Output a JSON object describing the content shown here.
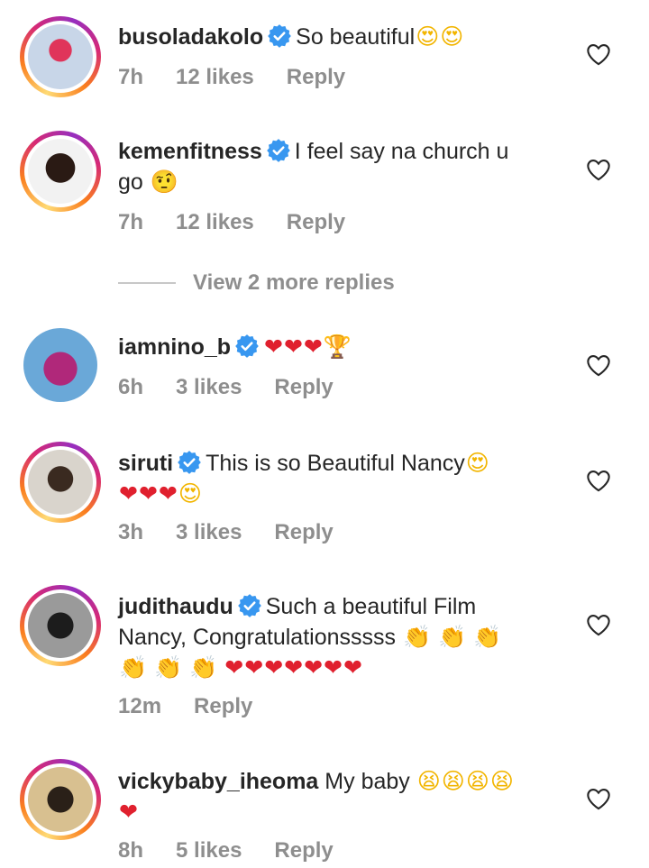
{
  "comments": [
    {
      "username": "busoladakolo",
      "verified": true,
      "text": "So beautiful",
      "emojis_inline": [
        "😍",
        "😍"
      ],
      "emojis_line2": [],
      "time": "7h",
      "likes": "12 likes",
      "reply": "Reply",
      "avatar_colors": [
        "#c8d6e8",
        "#e0345a"
      ]
    },
    {
      "username": "kemenfitness",
      "verified": true,
      "text": "I feel say na church u",
      "text_line2": "go",
      "emojis_line2": [
        "🤨"
      ],
      "time": "7h",
      "likes": "12 likes",
      "reply": "Reply",
      "avatar_colors": [
        "#f2f2f2",
        "#2a1a14"
      ]
    },
    {
      "username": "iamnino_b",
      "verified": true,
      "text": "",
      "emojis_inline": [
        "❤",
        "❤",
        "❤",
        "🏆"
      ],
      "time": "6h",
      "likes": "3 likes",
      "reply": "Reply",
      "avatar_colors": [
        "#6aa8d8",
        "#b0287a"
      ]
    },
    {
      "username": "siruti",
      "verified": true,
      "text": "This is so Beautiful Nancy",
      "emojis_inline": [
        "😍"
      ],
      "emojis_line2": [
        "❤",
        "❤",
        "❤",
        "😍"
      ],
      "time": "3h",
      "likes": "3 likes",
      "reply": "Reply",
      "avatar_colors": [
        "#d9d4cc",
        "#3a2a20"
      ]
    },
    {
      "username": "judithaudu",
      "verified": true,
      "text": "Such a beautiful Film",
      "text_line2": "Nancy, Congratulationsssss",
      "emojis_line2": [
        "👏",
        "👏",
        "👏"
      ],
      "emojis_line3": [
        "👏",
        "👏",
        "👏",
        "❤",
        "❤",
        "❤",
        "❤",
        "❤",
        "❤",
        "❤"
      ],
      "time": "12m",
      "reply": "Reply",
      "avatar_colors": [
        "#9a9a9a",
        "#1c1c1c"
      ]
    },
    {
      "username": "vickybaby_iheoma",
      "verified": false,
      "text": "My baby",
      "emojis_inline": [
        "😫",
        "😫",
        "😫",
        "😫"
      ],
      "emojis_line2": [
        "❤"
      ],
      "time": "8h",
      "likes": "5 likes",
      "reply": "Reply",
      "avatar_colors": [
        "#d8c090",
        "#2a2018"
      ]
    }
  ],
  "view_more_replies": "View 2 more replies",
  "icons": {
    "verified": "verified-badge-icon",
    "like": "heart-outline-icon"
  },
  "colors": {
    "verified": "#3897f0",
    "meta_text": "#8e8e8e",
    "primary_text": "#262626"
  }
}
